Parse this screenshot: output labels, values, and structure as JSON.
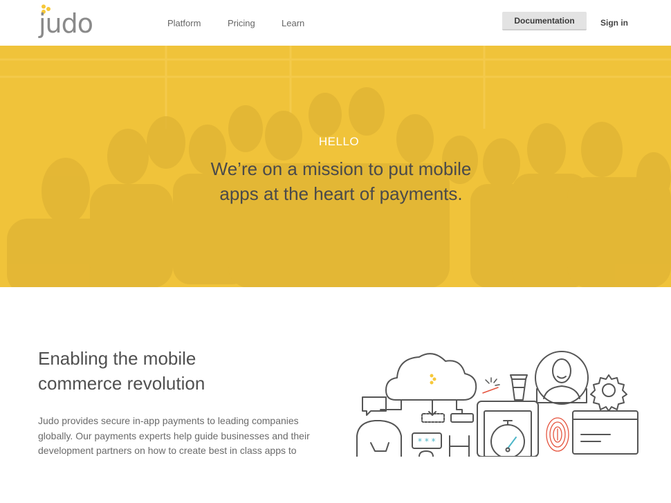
{
  "header": {
    "logo_text": "judo",
    "nav": [
      {
        "label": "Platform"
      },
      {
        "label": "Pricing"
      },
      {
        "label": "Learn"
      }
    ],
    "documentation_label": "Documentation",
    "signin_label": "Sign in"
  },
  "hero": {
    "kicker": "HELLO",
    "title_line1": "We’re on a mission to put mobile",
    "title_line2": "apps at the heart of payments."
  },
  "section": {
    "title_line1": "Enabling the mobile",
    "title_line2": "commerce revolution",
    "body": "Judo provides secure in-app payments to leading companies globally. Our payments experts help guide businesses and their development partners on how to create best in class apps to"
  },
  "colors": {
    "brand_yellow": "#f6c83a",
    "logo_gray": "#8a8a8a",
    "hero_text": "#4a4a4a"
  },
  "icons": [
    "judo-logo-dots-icon",
    "cloud-icon",
    "chat-bubble-icon",
    "coffee-cup-icon",
    "user-avatar-icon",
    "gear-icon",
    "fingerprint-icon",
    "credit-card-icon",
    "stopwatch-icon",
    "password-field-icon"
  ]
}
